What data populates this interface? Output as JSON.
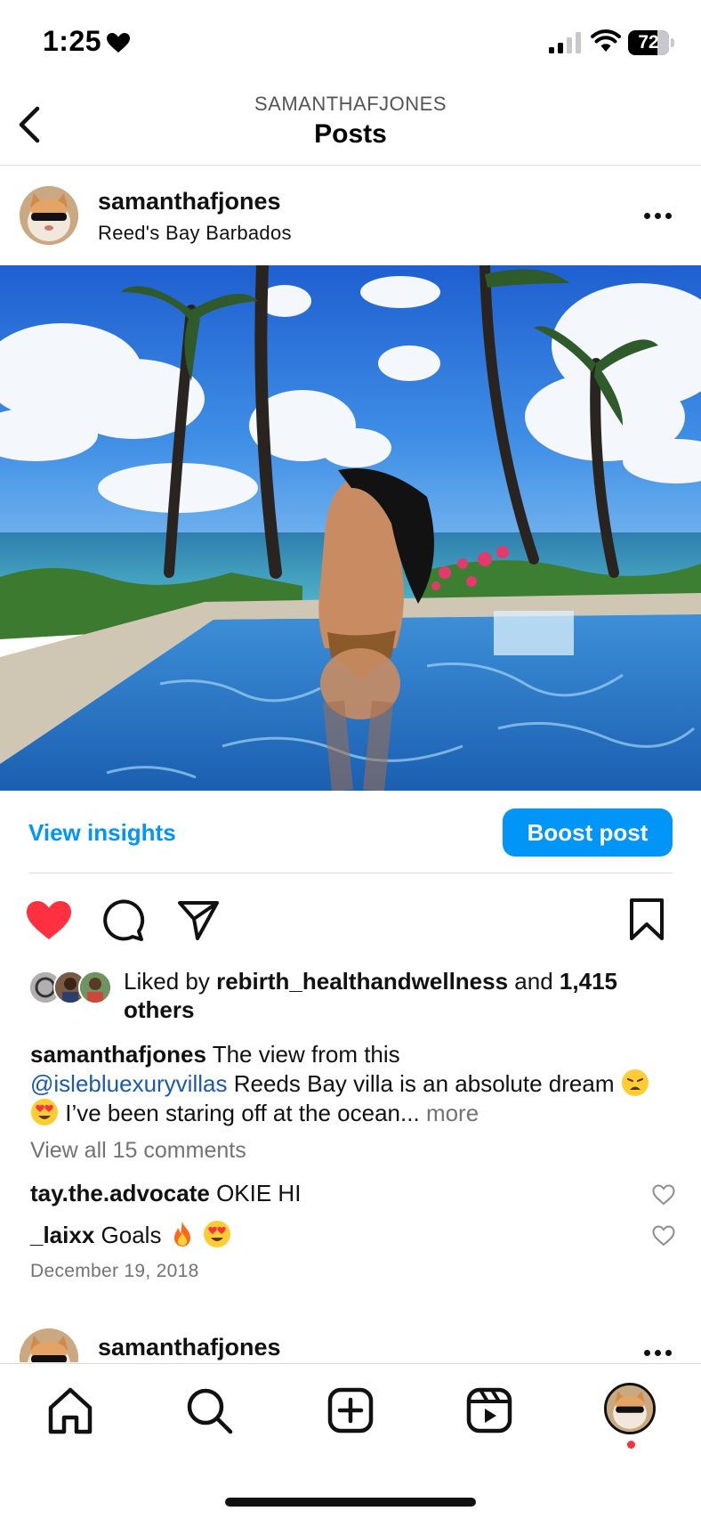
{
  "status_bar": {
    "time": "1:25",
    "battery": "72",
    "battery_level_percent": 72
  },
  "header": {
    "subtitle": "SAMANTHAFJONES",
    "title": "Posts"
  },
  "post": {
    "username": "samanthafjones",
    "location": "Reed's Bay Barbados",
    "image_icon": "beach-pool-photo"
  },
  "actions": {
    "insights_label": "View insights",
    "boost_label": "Boost post",
    "like_icon": "heart-filled-icon",
    "comment_icon": "comment-icon",
    "share_icon": "send-icon",
    "save_icon": "bookmark-icon"
  },
  "likes": {
    "prefix": "Liked by",
    "top_liker": "rebirth_healthandwellness",
    "joiner": "and",
    "others": "1,415 others"
  },
  "caption": {
    "username": "samanthafjones",
    "text_1": "The view from this",
    "mention": "@islebluexuryvillas",
    "text_2": "Reeds Bay villa is an absolute dream",
    "text_3": "I’ve been staring off at the ocean...",
    "more": "more"
  },
  "comments": {
    "view_all": "View all 15 comments",
    "items": [
      {
        "user": "tay.the.advocate",
        "text": "OKIE HI"
      },
      {
        "user": "_laixx",
        "text": "Goals"
      }
    ]
  },
  "date": "December 19, 2018",
  "next_post": {
    "username": "samanthafjones"
  },
  "colors": {
    "accent": "#0095f6",
    "like": "#ff3040",
    "mention": "#1c5aa8",
    "muted": "#737373"
  }
}
